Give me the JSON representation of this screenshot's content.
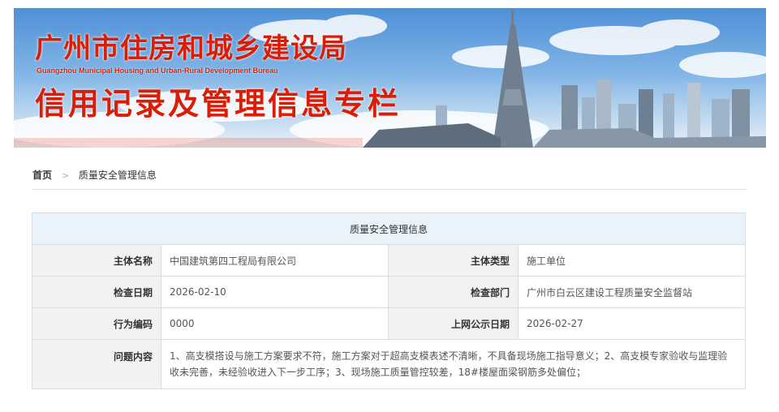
{
  "banner": {
    "title": "广州市住房和城乡建设局",
    "subtitle": "Guangzhou Municipal Housing and Urban-Rural Development Bureau",
    "slogan": "信用记录及管理信息专栏"
  },
  "breadcrumb": {
    "home": "首页",
    "separator": ">",
    "current": "质量安全管理信息"
  },
  "table": {
    "header": "质量安全管理信息",
    "entity_name_label": "主体名称",
    "entity_name": "中国建筑第四工程局有限公司",
    "entity_type_label": "主体类型",
    "entity_type": "施工单位",
    "inspection_date_label": "检查日期",
    "inspection_date": "2026-02-10",
    "inspection_dept_label": "检查部门",
    "inspection_dept": "广州市白云区建设工程质量安全监督站",
    "behavior_code_label": "行为编码",
    "behavior_code": "0000",
    "publish_date_label": "上网公示日期",
    "publish_date": "2026-02-27",
    "issue_label": "问题内容",
    "issue_content": "1、高支模搭设与施工方案要求不符，施工方案对于超高支模表述不清晰，不具备现场施工指导意义；2、高支模专家验收与监理验收未完善，未经验收进入下一步工序；3、现场施工质量管控较差，18#楼屋面梁钢筋多处偏位；"
  },
  "colors": {
    "banner_red": "#d81e06",
    "table_header_bg": "#e8f3fb",
    "label_bg": "#f2f2f2"
  }
}
